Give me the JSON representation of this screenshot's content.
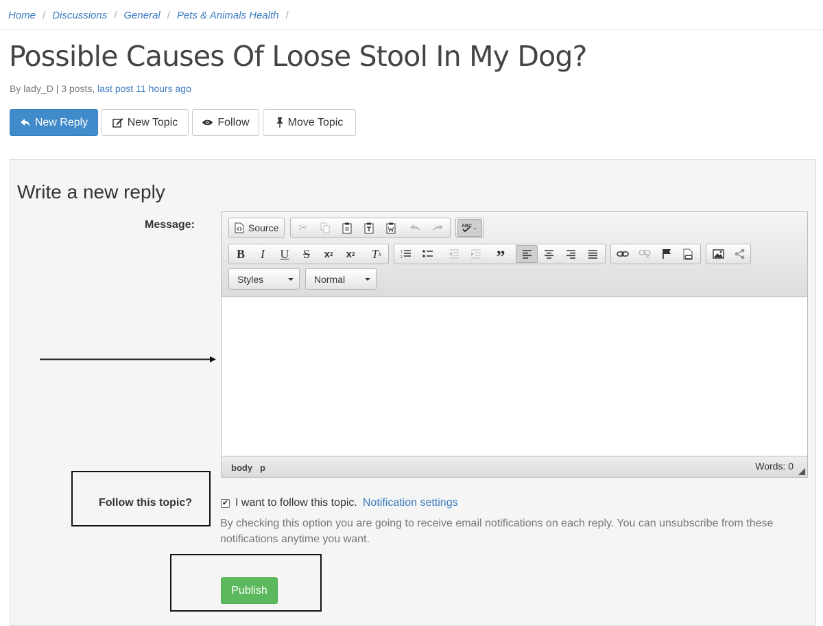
{
  "breadcrumb": {
    "items": [
      "Home",
      "Discussions",
      "General",
      "Pets & Animals Health"
    ],
    "separator": "/"
  },
  "topic": {
    "title": "Possible Causes Of Loose Stool In My Dog?",
    "meta_prefix": "By lady_D | 3 posts,",
    "meta_link": "last post 11 hours ago"
  },
  "actions": {
    "new_reply": "New Reply",
    "new_topic": "New Topic",
    "follow": "Follow",
    "move_topic": "Move Topic"
  },
  "reply_form": {
    "heading": "Write a new reply",
    "message_label": "Message:",
    "editor": {
      "source_label": "Source",
      "styles_label": "Styles",
      "format_label": "Normal",
      "elements_path": [
        "body",
        "p"
      ],
      "word_count": "Words: 0"
    },
    "follow_label": "Follow this topic?",
    "follow_checkbox_label": "I want to follow this topic.",
    "follow_checked": true,
    "notification_link": "Notification settings",
    "follow_help": "By checking this option you are going to receive email notifications on each reply. You can unsubscribe from these notifications anytime you want.",
    "publish_label": "Publish"
  },
  "colors": {
    "link": "#3a7bbf",
    "primary": "#428bca",
    "success": "#5cb85c"
  }
}
